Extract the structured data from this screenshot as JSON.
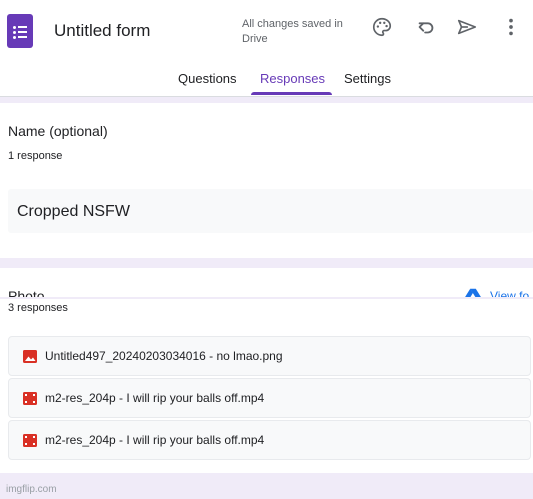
{
  "header": {
    "form_title": "Untitled form",
    "save_status": "All changes saved in Drive",
    "icons": [
      "palette-icon",
      "undo-icon",
      "send-icon",
      "more-vert-icon"
    ],
    "accent_color": "#673ab7"
  },
  "tabs": [
    {
      "label": "Questions",
      "active": false
    },
    {
      "label": "Responses",
      "active": true
    },
    {
      "label": "Settings",
      "active": false
    }
  ],
  "questions": [
    {
      "title": "Name (optional)",
      "response_count": "1 response",
      "answer": "Cropped NSFW"
    },
    {
      "title": "Photo",
      "response_count": "3 responses",
      "view_folder_label": "View fo",
      "files": [
        {
          "name": "Untitled497_20240203034016 - no lmao.png",
          "type": "image",
          "icon": "image-file-icon",
          "icon_color": "#d93025"
        },
        {
          "name": "m2-res_204p - I will rip your balls off.mp4",
          "type": "video",
          "icon": "video-file-icon",
          "icon_color": "#d93025"
        },
        {
          "name": "m2-res_204p - I will rip your balls off.mp4",
          "type": "video",
          "icon": "video-file-icon",
          "icon_color": "#d93025"
        }
      ]
    }
  ],
  "watermark": "imgflip.com"
}
